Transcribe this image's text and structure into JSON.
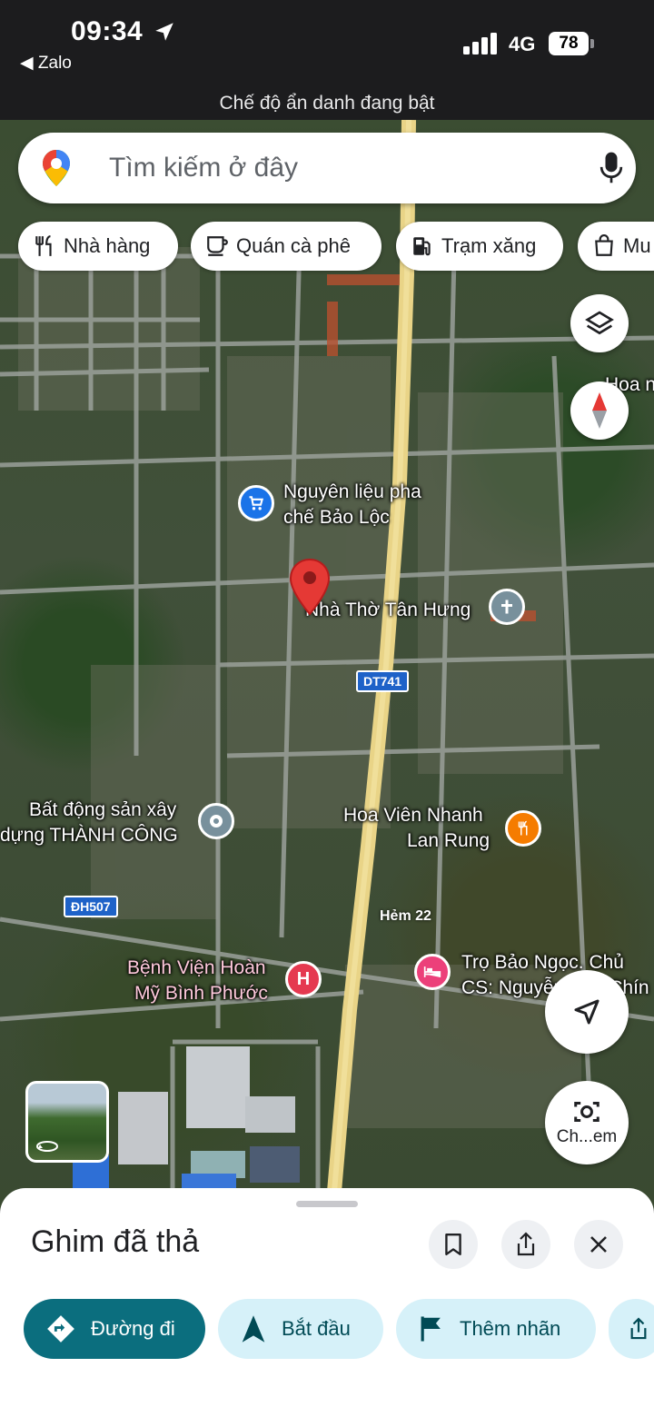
{
  "status_bar": {
    "time": "09:34",
    "back_app": "◀ Zalo",
    "network": "4G",
    "battery": "78",
    "incognito_text": "Chế độ ẩn danh đang bật"
  },
  "search": {
    "placeholder": "Tìm kiếm ở đây"
  },
  "chips": [
    {
      "label": "Nhà hàng",
      "icon": "fork-knife-icon"
    },
    {
      "label": "Quán cà phê",
      "icon": "coffee-cup-icon"
    },
    {
      "label": "Trạm xăng",
      "icon": "gas-station-icon"
    },
    {
      "label": "Mu",
      "icon": "shopping-bag-icon"
    }
  ],
  "map": {
    "labels": {
      "hoa_partial": "Hoa n",
      "nguyen_lieu_1": "Nguyên liệu pha",
      "nguyen_lieu_2": "chế Bảo Lộc",
      "nha_tho": "Nhà Thờ Tân Hưng",
      "bds_1": "Bất động sản xây",
      "bds_2": "dựng THÀNH CÔNG",
      "hoa_vien_1": "Hoa Viên Nhanh",
      "hoa_vien_2": "Lan Rung",
      "hem": "Hẻm 22",
      "benh_vien_1": "Bệnh Viện Hoàn",
      "benh_vien_2": "Mỹ Bình Phước",
      "tro_1": "Trọ Bảo Ngọc. Chủ",
      "tro_2": "CS: Nguyễn Văn Chín"
    },
    "shields": {
      "dt741": "DT741",
      "dh507": "ĐH507"
    },
    "camera_label": "Ch...em"
  },
  "sheet": {
    "title": "Ghim đã thả",
    "actions": {
      "directions": "Đường đi",
      "start": "Bắt đầu",
      "add_label": "Thêm nhãn"
    }
  },
  "colors": {
    "primary": "#0b6e7e",
    "secondary": "#d6f1f9",
    "pin": "#e53935",
    "main_road": "#e9d487"
  }
}
